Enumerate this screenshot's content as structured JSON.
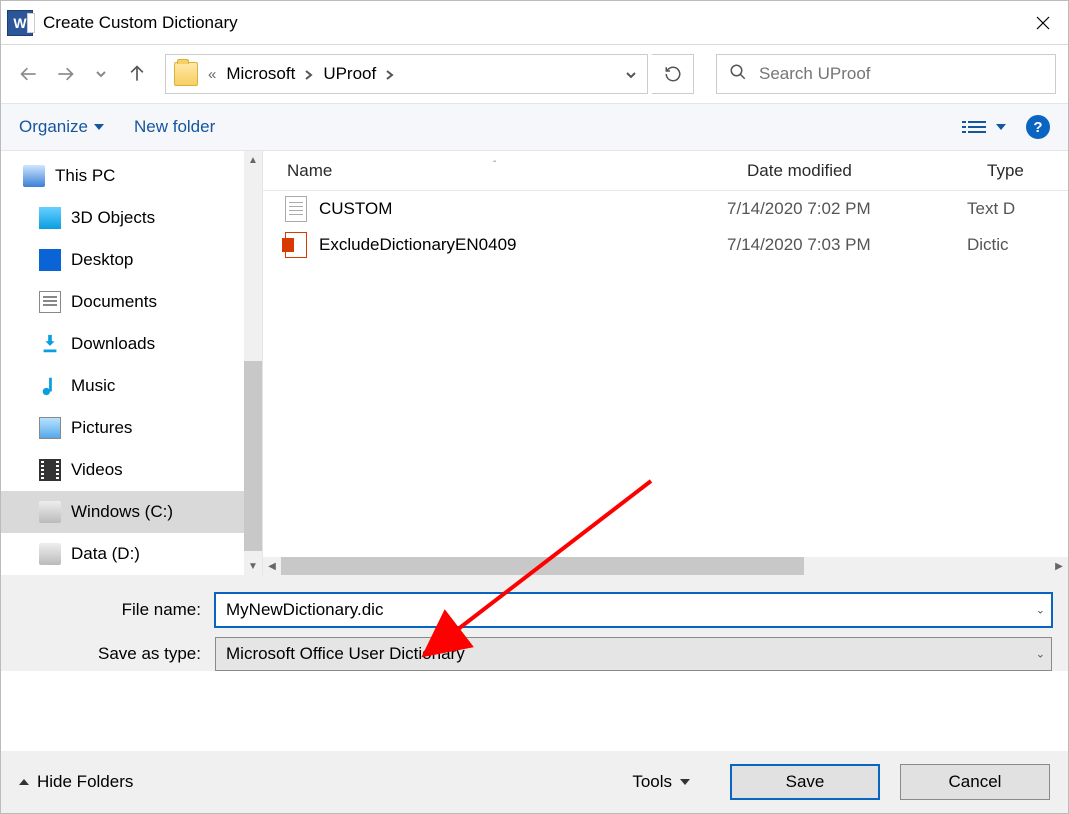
{
  "window": {
    "title": "Create Custom Dictionary"
  },
  "breadcrumb": {
    "prefix": "«",
    "part1": "Microsoft",
    "part2": "UProof"
  },
  "search": {
    "placeholder": "Search UProof"
  },
  "toolbar": {
    "organize": "Organize",
    "new_folder": "New folder"
  },
  "columns": {
    "name": "Name",
    "date": "Date modified",
    "type": "Type"
  },
  "tree": {
    "this_pc": "This PC",
    "items": [
      "3D Objects",
      "Desktop",
      "Documents",
      "Downloads",
      "Music",
      "Pictures",
      "Videos",
      "Windows (C:)",
      "Data (D:)"
    ]
  },
  "files": [
    {
      "name": "CUSTOM",
      "date": "7/14/2020 7:02 PM",
      "type": "Text D"
    },
    {
      "name": "ExcludeDictionaryEN0409",
      "date": "7/14/2020 7:03 PM",
      "type": "Dictic"
    }
  ],
  "form": {
    "filename_label": "File name:",
    "filename_value": "MyNewDictionary.dic",
    "savetype_label": "Save as type:",
    "savetype_value": "Microsoft Office User Dictionary"
  },
  "footer": {
    "hide_folders": "Hide Folders",
    "tools": "Tools",
    "save": "Save",
    "cancel": "Cancel"
  }
}
